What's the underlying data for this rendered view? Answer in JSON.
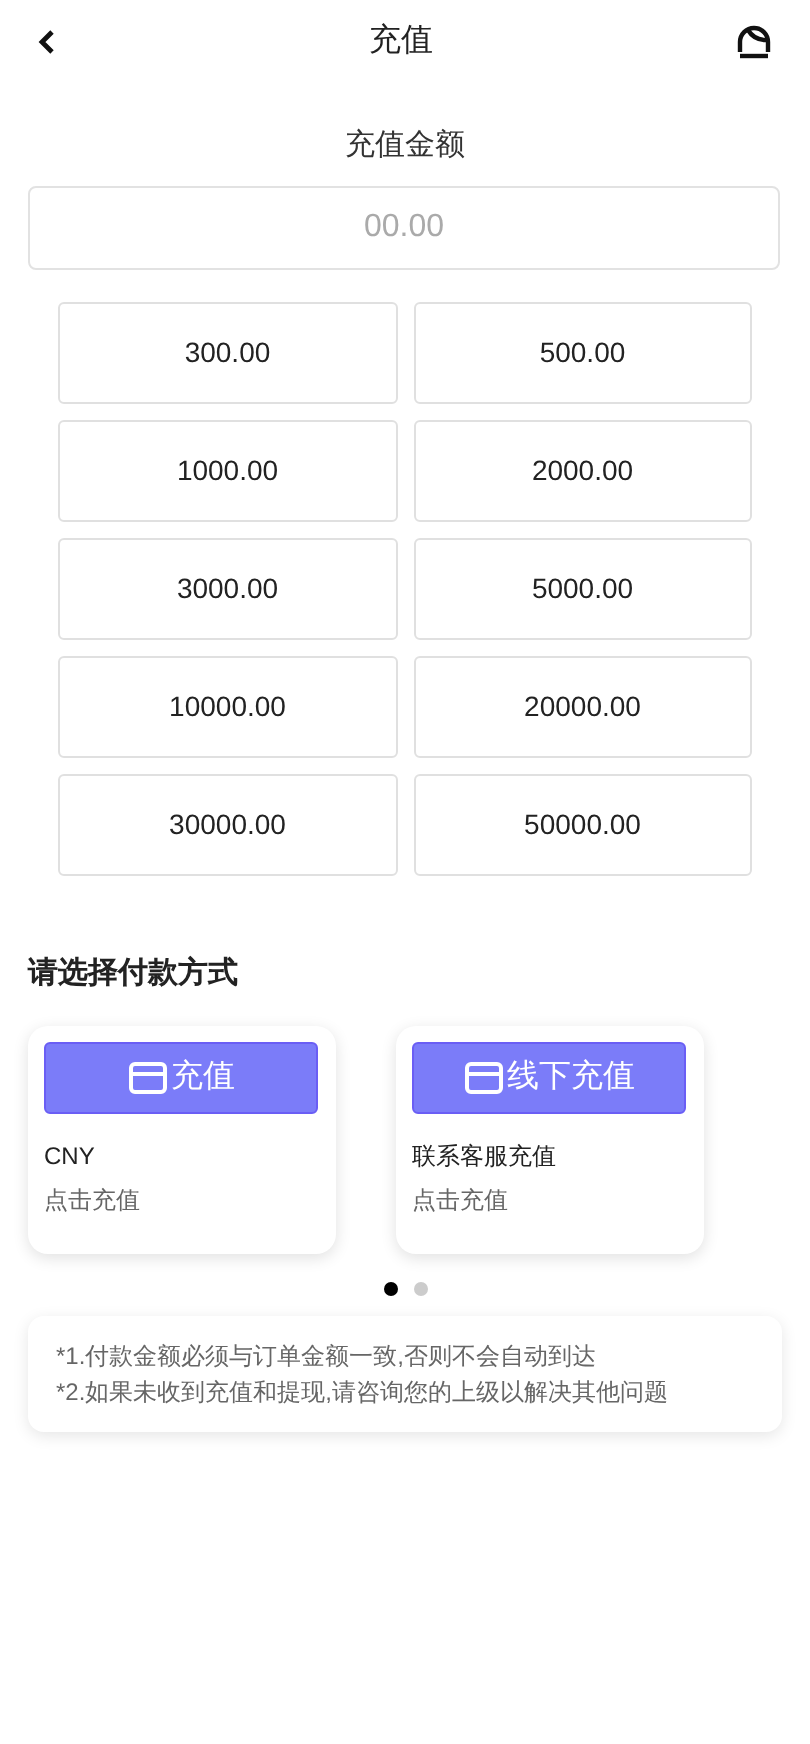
{
  "header": {
    "title": "充值"
  },
  "amount": {
    "label": "充值金额",
    "placeholder": "00.00"
  },
  "presets": [
    "300.00",
    "500.00",
    "1000.00",
    "2000.00",
    "3000.00",
    "5000.00",
    "10000.00",
    "20000.00",
    "30000.00",
    "50000.00"
  ],
  "payment": {
    "heading": "请选择付款方式",
    "methods": [
      {
        "button": "充值",
        "name": "CNY",
        "hint": "点击充值"
      },
      {
        "button": "线下充值",
        "name": "联系客服充值",
        "hint": "点击充值"
      }
    ],
    "dots": [
      {
        "selected": true
      },
      {
        "selected": false
      }
    ]
  },
  "notes": [
    "*1.付款金额必须与订单金额一致,否则不会自动到达",
    "*2.如果未收到充值和提现,请咨询您的上级以解决其他问题"
  ]
}
